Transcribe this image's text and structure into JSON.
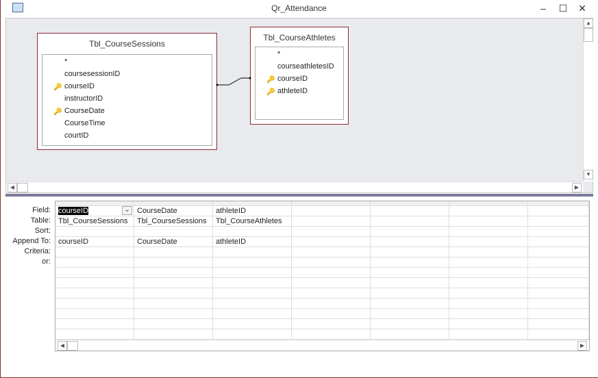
{
  "window": {
    "title": "Qr_Attendance",
    "minimize": "–",
    "maximize": "☐",
    "close": "✕"
  },
  "tables": [
    {
      "name": "Tbl_CourseSessions",
      "fields": [
        {
          "name": "*",
          "key": false
        },
        {
          "name": "coursesessionID",
          "key": false
        },
        {
          "name": "courseID",
          "key": true
        },
        {
          "name": "instructorID",
          "key": false
        },
        {
          "name": "CourseDate",
          "key": true
        },
        {
          "name": "CourseTime",
          "key": false
        },
        {
          "name": "courtID",
          "key": false
        }
      ]
    },
    {
      "name": "Tbl_CourseAthletes",
      "fields": [
        {
          "name": "*",
          "key": false
        },
        {
          "name": "courseathletesID",
          "key": false
        },
        {
          "name": "courseID",
          "key": true
        },
        {
          "name": "athleteID",
          "key": true
        }
      ]
    }
  ],
  "grid": {
    "row_labels": [
      "Field:",
      "Table:",
      "Sort:",
      "Append To:",
      "Criteria:",
      "or:"
    ],
    "columns": [
      {
        "field": "courseID",
        "table": "Tbl_CourseSessions",
        "sort": "",
        "append_to": "courseID",
        "criteria": "",
        "or": ""
      },
      {
        "field": "CourseDate",
        "table": "Tbl_CourseSessions",
        "sort": "",
        "append_to": "CourseDate",
        "criteria": "",
        "or": ""
      },
      {
        "field": "athleteID",
        "table": "Tbl_CourseAthletes",
        "sort": "",
        "append_to": "athleteID",
        "criteria": "",
        "or": ""
      }
    ]
  }
}
